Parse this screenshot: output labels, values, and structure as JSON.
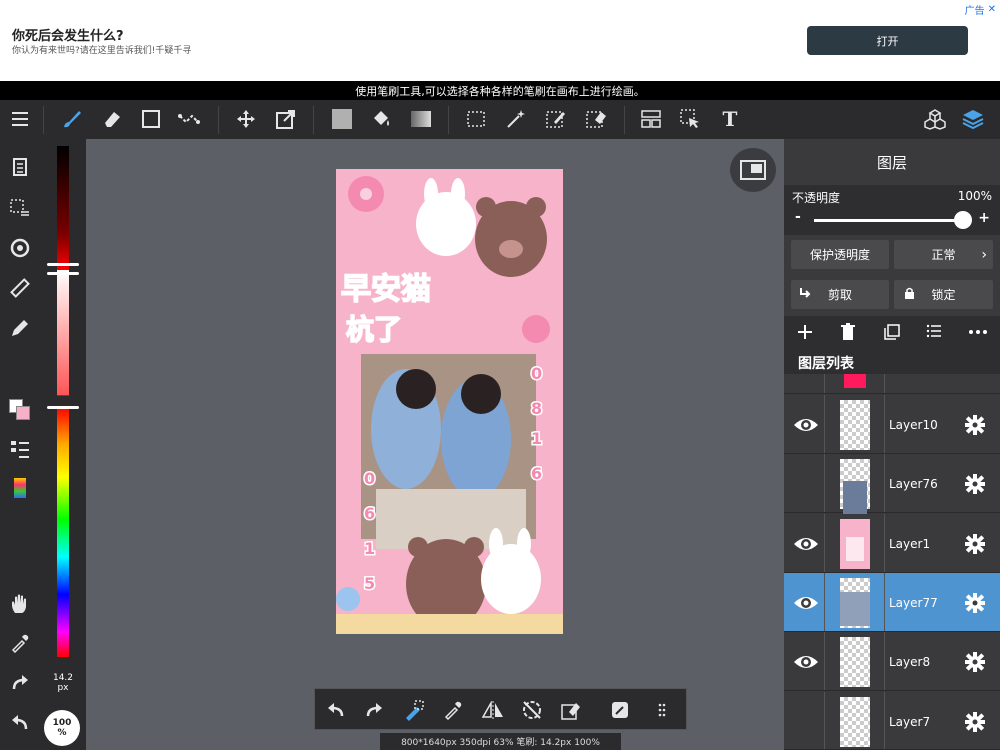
{
  "ad": {
    "title": "你死后会发生什么?",
    "subtitle": "你认为有来世吗?请在这里告诉我们!千疑千寻",
    "button": "打开",
    "tag": "广告"
  },
  "hint": "使用笔刷工具,可以选择各种各样的笔刷在画布上进行绘画。",
  "toolbar": {
    "menu_icon": "menu-icon",
    "tools": [
      "brush-icon",
      "eraser-icon",
      "rect-select-icon",
      "lasso-icon",
      "move-icon",
      "transform-icon",
      "fill-color-icon",
      "bucket-icon",
      "gradient-icon",
      "select-rect-icon",
      "magic-wand-icon",
      "select-pen-icon",
      "select-eraser-icon",
      "panel-icon",
      "select-arrow-icon",
      "text-icon",
      "materials-icon",
      "layers-icon"
    ],
    "text_tool_label": "T"
  },
  "left_bar": {
    "brush_size": "14.2\npx",
    "zoom": "100\n%"
  },
  "bottom_bar": {
    "status": "800*1640px 350dpi 63% 笔刷: 14.2px 100%"
  },
  "layers_panel": {
    "title": "图层",
    "opacity_label": "不透明度",
    "opacity_value": "100%",
    "opacity_level": 1.0,
    "minus": "-",
    "plus": "+",
    "protect_alpha": "保护透明度",
    "blend_mode": "正常",
    "clip": "剪取",
    "lock": "锁定",
    "list_title": "图层列表",
    "layers": [
      {
        "name": "Layer10",
        "visible": true,
        "selected": false
      },
      {
        "name": "Layer76",
        "visible": false,
        "selected": false
      },
      {
        "name": "Layer1",
        "visible": true,
        "selected": false
      },
      {
        "name": "Layer77",
        "visible": true,
        "selected": true
      },
      {
        "name": "Layer8",
        "visible": true,
        "selected": false
      },
      {
        "name": "Layer7",
        "visible": false,
        "selected": false
      }
    ]
  },
  "artwork": {
    "title_text": "早安猫 杭了",
    "digits": [
      "0",
      "8",
      "1",
      "6",
      "0",
      "6",
      "1",
      "5"
    ]
  },
  "colors": {
    "accent": "#4d94d0",
    "panel_bg": "#3a3a3c",
    "toolbar_bg": "#2b2b2d",
    "canvas_bg": "#5c5f66",
    "brush_blue": "#4aa3e8"
  }
}
